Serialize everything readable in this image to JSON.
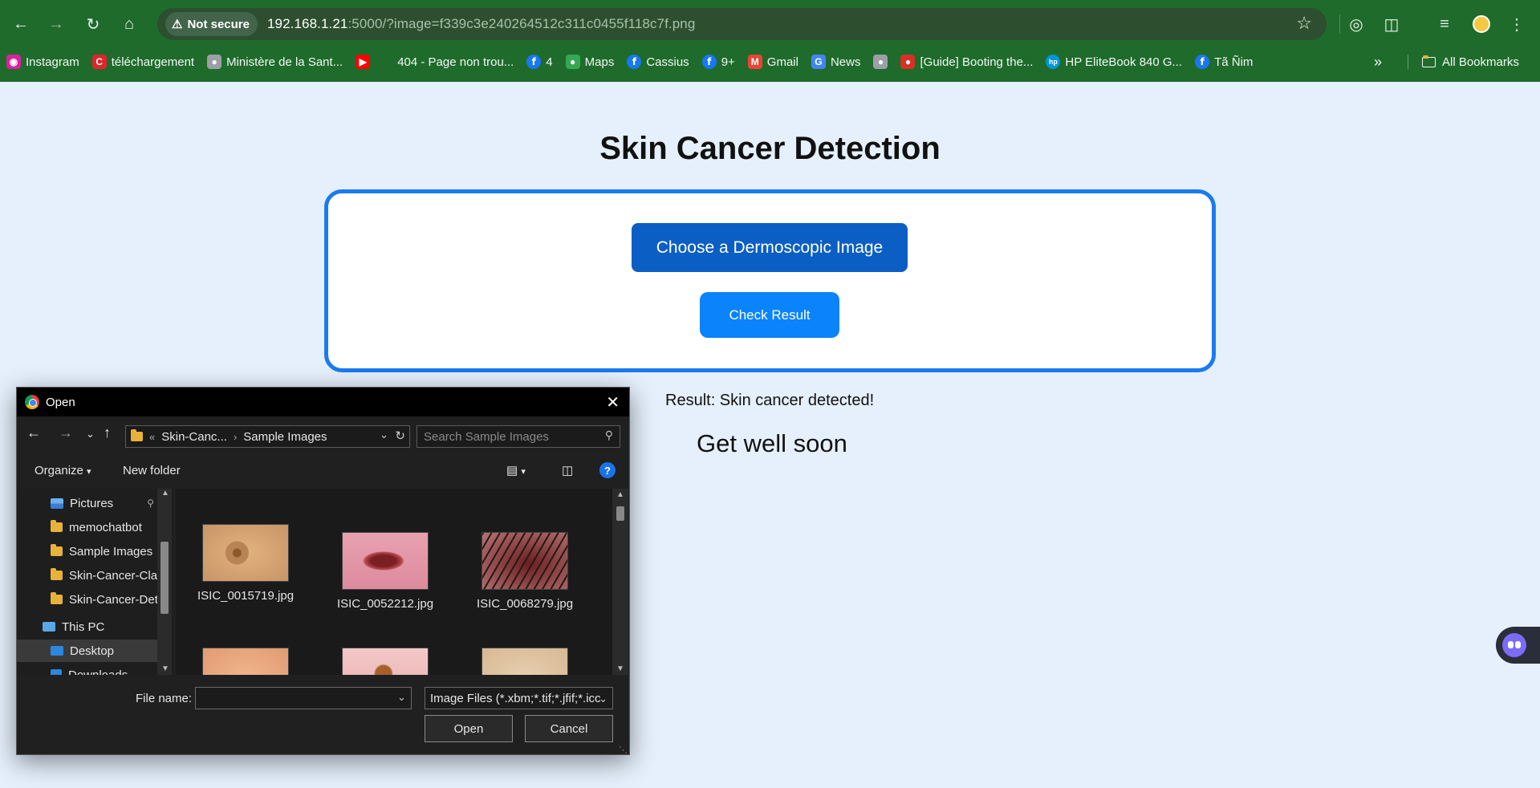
{
  "browser": {
    "security_label": "Not secure",
    "url_host": "192.168.1.21",
    "url_rest": ":5000/?image=f339c3e240264512c311c0455f118c7f.png",
    "bookmarks": [
      {
        "label": "Instagram",
        "icon": "instagram-icon",
        "color": "#d6249f"
      },
      {
        "label": "téléchargement",
        "icon": "letter-c-icon",
        "color": "#e0242c"
      },
      {
        "label": "Ministère de la Sant...",
        "icon": "globe-icon",
        "color": "#9aa0a6"
      },
      {
        "label": "",
        "icon": "youtube-icon",
        "color": "#ff0000"
      },
      {
        "label": "404 - Page non trou...",
        "icon": "blank-icon",
        "color": "#1f6b2c"
      },
      {
        "label": "4",
        "icon": "facebook-icon",
        "color": "#1877f2"
      },
      {
        "label": "Maps",
        "icon": "maps-icon",
        "color": "#34a853"
      },
      {
        "label": "Cassius",
        "icon": "facebook-icon",
        "color": "#1877f2"
      },
      {
        "label": "9+",
        "icon": "facebook-icon",
        "color": "#1877f2"
      },
      {
        "label": "Gmail",
        "icon": "gmail-icon",
        "color": "#ea4335"
      },
      {
        "label": "News",
        "icon": "google-news-icon",
        "color": "#4285f4"
      },
      {
        "label": "",
        "icon": "globe-icon",
        "color": "#9aa0a6"
      },
      {
        "label": "[Guide] Booting the...",
        "icon": "tomato-icon",
        "color": "#d93025"
      },
      {
        "label": "HP EliteBook 840 G...",
        "icon": "hp-icon",
        "color": "#0096d6"
      },
      {
        "label": "Tã Ñim",
        "icon": "facebook-icon",
        "color": "#1877f2"
      }
    ],
    "all_bookmarks_label": "All Bookmarks",
    "chrome_color": "#1f6b2c"
  },
  "page": {
    "title": "Skin Cancer Detection",
    "choose_button": "Choose a Dermoscopic Image",
    "check_button": "Check Result",
    "result": "Result: Skin cancer detected!",
    "wish": "Get well soon",
    "accent": "#1a7bef",
    "background": "#e5f0fc"
  },
  "dialog": {
    "title": "Open",
    "breadcrumb": [
      "Skin-Canc...",
      "Sample Images"
    ],
    "search_placeholder": "Search Sample Images",
    "organize_label": "Organize",
    "new_folder_label": "New folder",
    "nav_items": [
      {
        "label": "Pictures",
        "icon": "pictures-icon",
        "pinned": true
      },
      {
        "label": "memochatbot",
        "icon": "folder-icon"
      },
      {
        "label": "Sample Images",
        "icon": "folder-icon"
      },
      {
        "label": "Skin-Cancer-Clas",
        "icon": "folder-icon"
      },
      {
        "label": "Skin-Cancer-Det",
        "icon": "folder-icon"
      },
      {
        "label": "This PC",
        "icon": "pc-icon"
      },
      {
        "label": "Desktop",
        "icon": "desktop-icon",
        "selected": true
      },
      {
        "label": "Downloads",
        "icon": "downloads-icon"
      }
    ],
    "files": [
      {
        "name": "ISIC_0015719.jpg"
      },
      {
        "name": "ISIC_0052212.jpg"
      },
      {
        "name": "ISIC_0068279.jpg"
      },
      {
        "name": ""
      },
      {
        "name": ""
      },
      {
        "name": ""
      }
    ],
    "file_name_label": "File name:",
    "file_name_value": "",
    "filter_label": "Image Files (*.xbm;*.tif;*.jfif;*.icc",
    "open_label": "Open",
    "cancel_label": "Cancel"
  }
}
